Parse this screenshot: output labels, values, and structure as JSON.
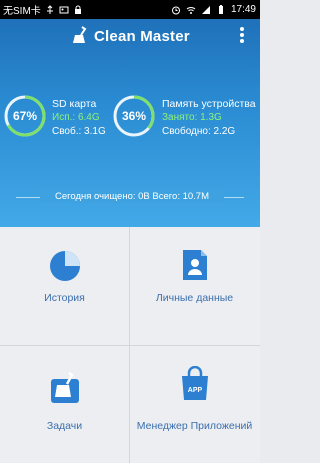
{
  "status_bar": {
    "carrier": "无SIM卡",
    "time": "17:49"
  },
  "app": {
    "title": "Clean Master"
  },
  "storage": {
    "sd": {
      "percent": "67%",
      "percent_value": 0.67,
      "title": "SD карта",
      "used": "Исп.: 6.4G",
      "free": "Своб.: 3.1G"
    },
    "device": {
      "percent": "36%",
      "percent_value": 0.36,
      "title": "Память устройства",
      "used": "Занято: 1.3G",
      "free": "Свободно: 2.2G"
    }
  },
  "summary": "Сегодня очищено: 0В Всего: 10.7M",
  "tiles": [
    {
      "label": "История",
      "icon": "pie-chart-icon"
    },
    {
      "label": "Личные данные",
      "icon": "contact-card-icon"
    },
    {
      "label": "Задачи",
      "icon": "broom-icon"
    },
    {
      "label": "Менеджер Приложений",
      "icon": "app-bag-icon"
    }
  ],
  "colors": {
    "header_top": "#1f71b9",
    "header_bottom": "#43a9e7",
    "ring": "#7fe06a",
    "icon_blue": "#2d7fd1"
  }
}
